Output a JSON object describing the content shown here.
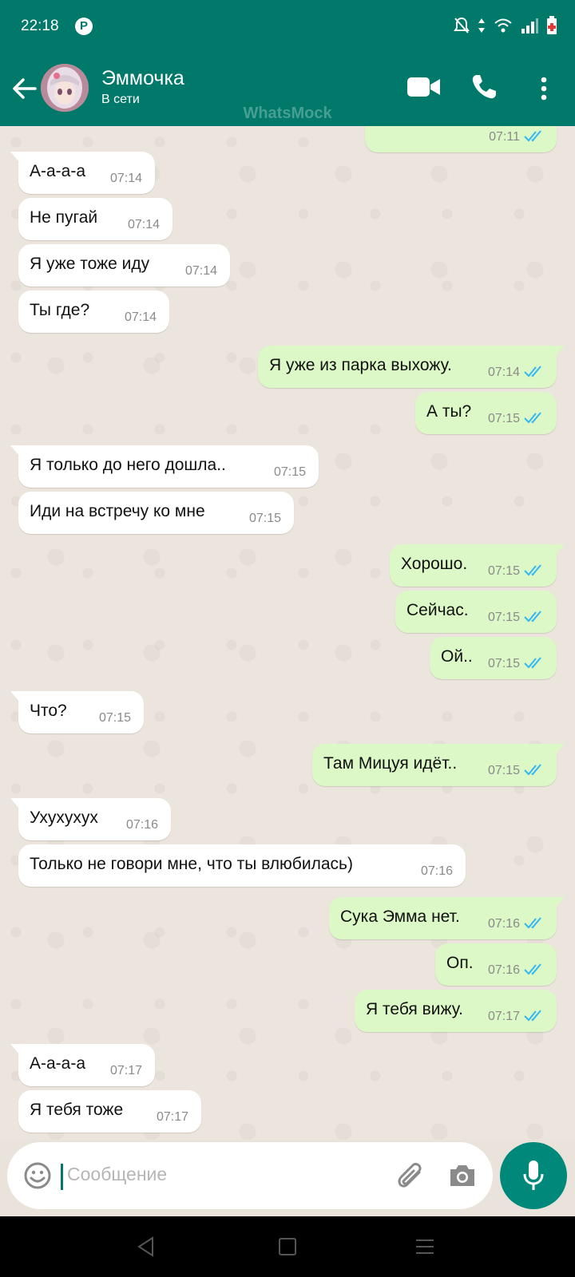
{
  "status_bar": {
    "time": "22:18"
  },
  "header": {
    "contact_name": "Эммочка",
    "contact_status": "В сети",
    "watermark": "WhatsMock"
  },
  "messages": [
    {
      "direction": "out",
      "text": "",
      "time": "07:11",
      "ticks": "read"
    },
    {
      "direction": "in",
      "text": "А-а-а-а",
      "time": "07:14"
    },
    {
      "direction": "in",
      "text": "Не пугай",
      "time": "07:14"
    },
    {
      "direction": "in",
      "text": "Я уже тоже иду",
      "time": "07:14"
    },
    {
      "direction": "in",
      "text": "Ты где?",
      "time": "07:14"
    },
    {
      "direction": "out",
      "text": "Я уже из парка выхожу.",
      "time": "07:14",
      "ticks": "read"
    },
    {
      "direction": "out",
      "text": "А ты?",
      "time": "07:15",
      "ticks": "read"
    },
    {
      "direction": "in",
      "text": "Я только до него дошла..",
      "time": "07:15"
    },
    {
      "direction": "in",
      "text": "Иди на встречу ко мне",
      "time": "07:15"
    },
    {
      "direction": "out",
      "text": "Хорошо.",
      "time": "07:15",
      "ticks": "read"
    },
    {
      "direction": "out",
      "text": "Сейчас.",
      "time": "07:15",
      "ticks": "read"
    },
    {
      "direction": "out",
      "text": "Ой..",
      "time": "07:15",
      "ticks": "read"
    },
    {
      "direction": "in",
      "text": "Что?",
      "time": "07:15"
    },
    {
      "direction": "out",
      "text": "Там Мицуя идёт..",
      "time": "07:15",
      "ticks": "read"
    },
    {
      "direction": "in",
      "text": "Ухухухух",
      "time": "07:16"
    },
    {
      "direction": "in",
      "text": "Только не говори мне, что ты влюбилась)",
      "time": "07:16"
    },
    {
      "direction": "out",
      "text": "Сука Эмма нет.",
      "time": "07:16",
      "ticks": "read"
    },
    {
      "direction": "out",
      "text": "Оп.",
      "time": "07:16",
      "ticks": "read"
    },
    {
      "direction": "out",
      "text": "Я тебя вижу.",
      "time": "07:17",
      "ticks": "read"
    },
    {
      "direction": "in",
      "text": "А-а-а-а",
      "time": "07:17"
    },
    {
      "direction": "in",
      "text": "Я тебя тоже",
      "time": "07:17"
    }
  ],
  "input": {
    "placeholder": "Сообщение"
  },
  "colors": {
    "header": "#00796b",
    "mic_button": "#00897b",
    "incoming_bubble": "#ffffff",
    "outgoing_bubble": "#dcf8c6",
    "read_ticks": "#34b7f1"
  },
  "icons": [
    "back-arrow-icon",
    "video-call-icon",
    "phone-icon",
    "more-vert-icon",
    "emoji-icon",
    "paperclip-icon",
    "camera-icon",
    "mic-icon"
  ]
}
